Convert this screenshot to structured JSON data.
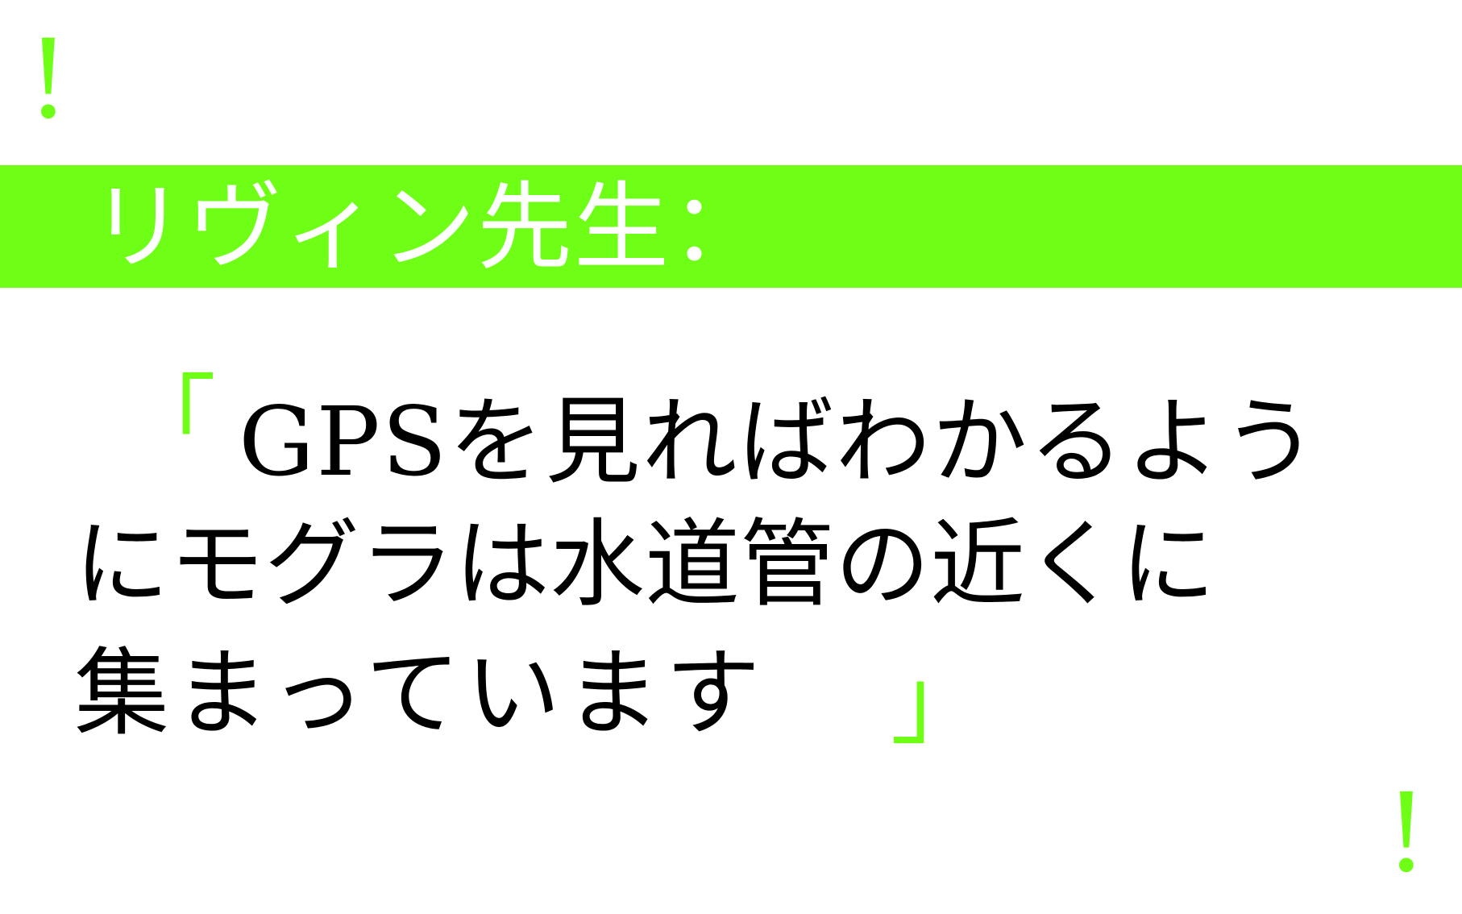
{
  "decoration": {
    "mark_top": "!",
    "mark_bottom": "!",
    "accent_color": "#6fff17"
  },
  "speaker": {
    "label": "リヴィン先生："
  },
  "quote": {
    "open_mark": "「",
    "close_mark": "」",
    "lines": [
      "GPSを見ればわかるよう",
      "にモグラは水道管の近くに",
      "集まっています"
    ]
  }
}
